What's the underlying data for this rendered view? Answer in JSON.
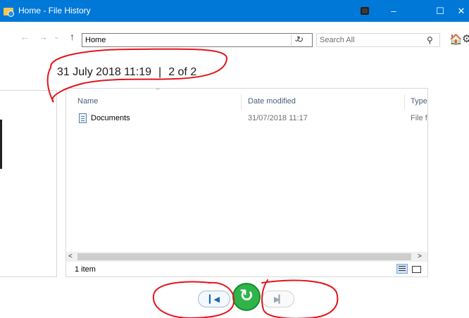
{
  "window": {
    "title": "Home - File History",
    "minimize_glyph": "–",
    "maximize_glyph": "☐",
    "close_glyph": "✕"
  },
  "nav": {
    "back_glyph": "←",
    "forward_glyph": "→",
    "recent_glyph": "⌄",
    "up_glyph": "↑",
    "address": "Home",
    "address_dropdown_glyph": "⌄",
    "refresh_glyph": "↻",
    "search_placeholder": "Search All",
    "search_glyph": "⚲",
    "home_glyph": "🏠",
    "settings_glyph": "⚙"
  },
  "snapshot": {
    "timestamp": "31 July 2018 11:19",
    "separator": "|",
    "position": "2 of 2"
  },
  "file_list": {
    "sort_glyph": "⌃",
    "columns": [
      "Name",
      "Date modified",
      "Type"
    ],
    "rows": [
      {
        "name": "Documents",
        "date_modified": "31/07/2018 11:17",
        "type": "File f"
      }
    ],
    "scroll_left_glyph": "<",
    "scroll_right_glyph": ">",
    "status": "1 item"
  },
  "controls": {
    "previous_glyph": "▎◀",
    "restore_glyph": "↻",
    "next_glyph": "▶▎"
  },
  "colors": {
    "titlebar": "#0078d7",
    "restore_button": "#2fb44a",
    "annotation": "#e3141c"
  }
}
